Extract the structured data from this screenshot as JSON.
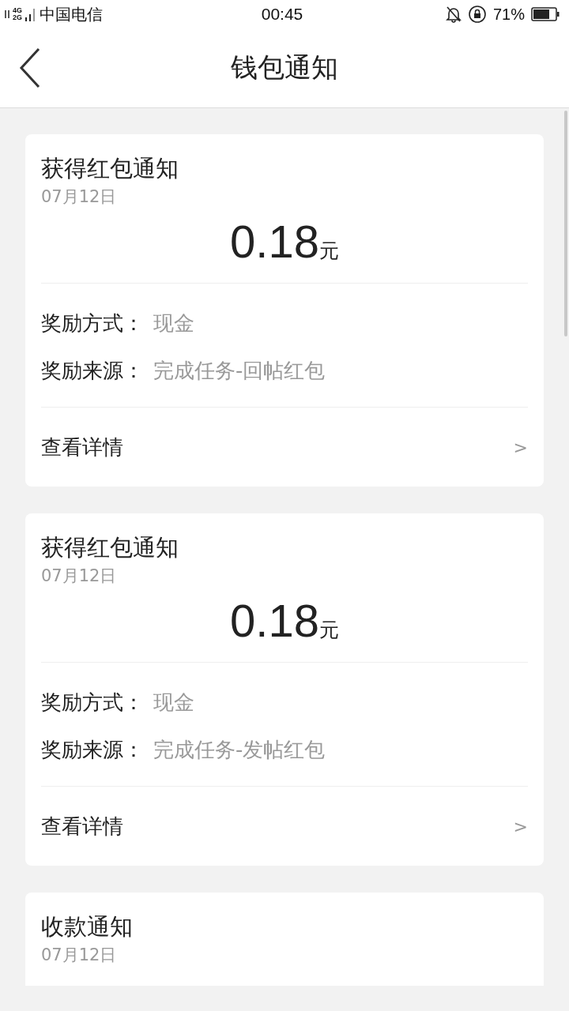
{
  "status_bar": {
    "carrier": "中国电信",
    "network_top": "4G",
    "network_bottom": "2G",
    "time": "00:45",
    "battery": "71%"
  },
  "header": {
    "title": "钱包通知"
  },
  "notices": [
    {
      "title": "获得红包通知",
      "date": "07月12日",
      "amount": "0.18",
      "unit": "元",
      "fields": [
        {
          "label": "奖励方式：",
          "value": "现金"
        },
        {
          "label": "奖励来源：",
          "value": "完成任务-回帖红包"
        }
      ],
      "link": "查看详情",
      "chevron": ">"
    },
    {
      "title": "获得红包通知",
      "date": "07月12日",
      "amount": "0.18",
      "unit": "元",
      "fields": [
        {
          "label": "奖励方式：",
          "value": "现金"
        },
        {
          "label": "奖励来源：",
          "value": "完成任务-发帖红包"
        }
      ],
      "link": "查看详情",
      "chevron": ">"
    },
    {
      "title": "收款通知",
      "date": "07月12日"
    }
  ]
}
